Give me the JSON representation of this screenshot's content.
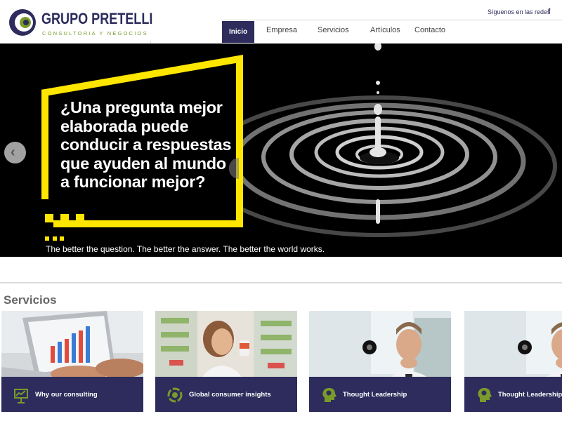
{
  "header": {
    "brand_name": "GRUPO PRETELLI",
    "brand_tagline": "CONSULTORIA Y NEGOCIOS",
    "follow_label": "Síguenos en las redes",
    "social_icon": "facebook-icon",
    "nav": [
      {
        "label": "Inicio",
        "active": true
      },
      {
        "label": "Empresa",
        "active": false
      },
      {
        "label": "Servicios",
        "active": false
      },
      {
        "label": "Artículos",
        "active": false
      },
      {
        "label": "Contacto",
        "active": false
      }
    ]
  },
  "hero": {
    "question": "¿Una pregunta mejor elaborada puede conducir a respuestas que ayuden al mundo a funcionar mejor?",
    "tagline": "The better the question. The better the answer. The better the world works.",
    "prev_icon": "chevron-left-icon"
  },
  "services": {
    "title": "Servicios",
    "cards": [
      {
        "label": "Why our consulting",
        "icon": "presentation-chart-icon"
      },
      {
        "label": "Global consumer insights",
        "icon": "cycle-icon"
      },
      {
        "label": "Thought Leadership",
        "icon": "idea-head-icon"
      },
      {
        "label": "Thought Leadership",
        "icon": "idea-head-icon"
      }
    ]
  },
  "colors": {
    "brand_navy": "#2d2c5c",
    "brand_green": "#7a9a2a",
    "accent_yellow": "#ffe600",
    "hero_bg": "#000000"
  }
}
